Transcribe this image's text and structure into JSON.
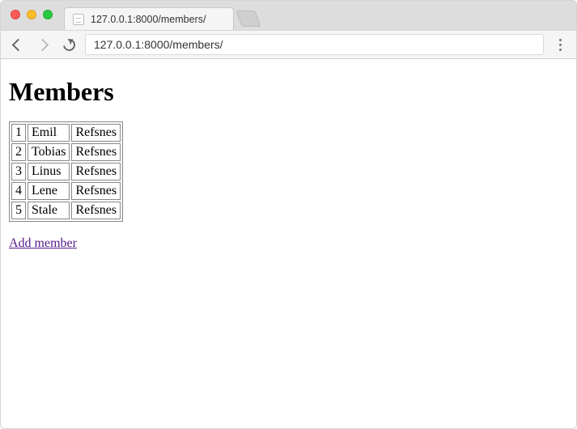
{
  "browser": {
    "tab_title": "127.0.0.1:8000/members/",
    "url": "127.0.0.1:8000/members/"
  },
  "page": {
    "heading": "Members",
    "members": [
      {
        "id": "1",
        "first": "Emil",
        "last": "Refsnes"
      },
      {
        "id": "2",
        "first": "Tobias",
        "last": "Refsnes"
      },
      {
        "id": "3",
        "first": "Linus",
        "last": "Refsnes"
      },
      {
        "id": "4",
        "first": "Lene",
        "last": "Refsnes"
      },
      {
        "id": "5",
        "first": "Stale",
        "last": "Refsnes"
      }
    ],
    "add_link_text": "Add member"
  }
}
